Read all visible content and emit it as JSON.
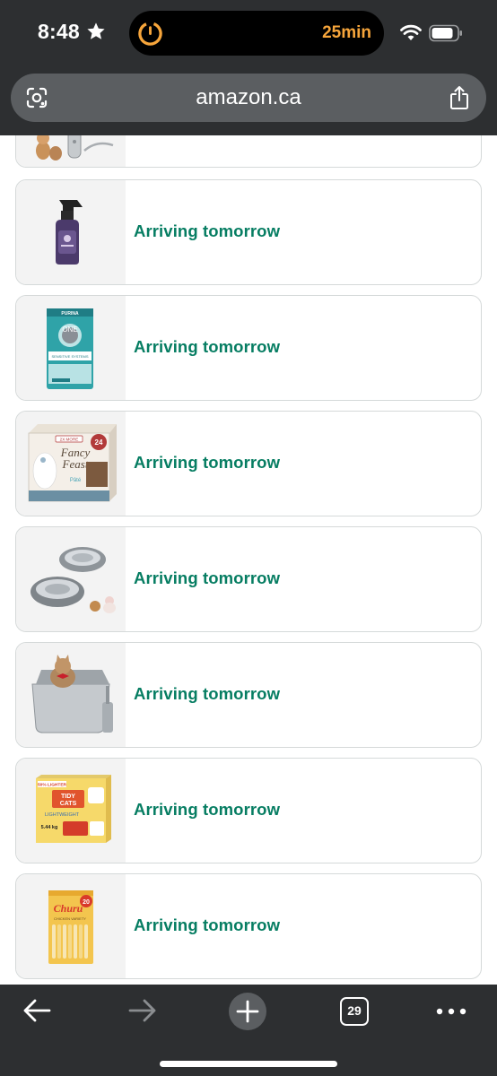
{
  "status_bar": {
    "time": "8:48",
    "timer_label": "25min",
    "icons": [
      "star-icon",
      "timer-icon",
      "wifi-icon",
      "battery-icon"
    ]
  },
  "browser": {
    "url": "amazon.ca",
    "tab_count": "29",
    "icons": [
      "lens-icon",
      "share-icon",
      "back-icon",
      "forward-icon",
      "plus-icon",
      "more-icon"
    ]
  },
  "orders": [
    {
      "status": "",
      "product_icon": "cat-toy-thumbnail"
    },
    {
      "status": "Arriving tomorrow",
      "product_icon": "spray-bottle-thumbnail"
    },
    {
      "status": "Arriving tomorrow",
      "product_icon": "cat-food-bag-thumbnail"
    },
    {
      "status": "Arriving tomorrow",
      "product_icon": "fancy-feast-box-thumbnail"
    },
    {
      "status": "Arriving tomorrow",
      "product_icon": "steel-bowls-thumbnail"
    },
    {
      "status": "Arriving tomorrow",
      "product_icon": "litter-box-thumbnail"
    },
    {
      "status": "Arriving tomorrow",
      "product_icon": "tidy-cats-box-thumbnail"
    },
    {
      "status": "Arriving tomorrow",
      "product_icon": "churu-box-thumbnail"
    }
  ],
  "product_text": {
    "purina": "PURINA",
    "one": "ONE",
    "sensitive": "SENSITIVE SYSTEMS",
    "more": "2X MORE",
    "can_count": "24",
    "fancy": "Fancy",
    "feast": "Feast",
    "pate": "Pâté",
    "lighter": "50% LIGHTER",
    "tidy": "TIDY",
    "cats": "CATS",
    "lightweight": "LIGHTWEIGHT",
    "weight": "5.44 kg",
    "churu": "Churu",
    "churu_count": "20",
    "churu_variety": "CHICKEN VARIETY"
  },
  "colors": {
    "chrome": "#2d2f31",
    "url_bar": "#5b5e61",
    "status_green": "#067d62",
    "timer_orange": "#f6a53b",
    "card_border": "#d5d9d9"
  }
}
